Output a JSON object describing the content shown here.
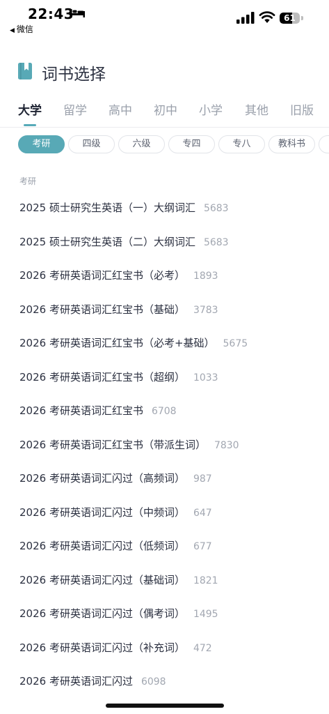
{
  "status_bar": {
    "time": "22:43",
    "back_app": "微信",
    "battery": "61",
    "battery_level": 0.61
  },
  "header": {
    "title": "词书选择",
    "accent_color": "#58a9b6"
  },
  "tabs": [
    {
      "label": "大学",
      "active": true
    },
    {
      "label": "留学",
      "active": false
    },
    {
      "label": "高中",
      "active": false
    },
    {
      "label": "初中",
      "active": false
    },
    {
      "label": "小学",
      "active": false
    },
    {
      "label": "其他",
      "active": false
    },
    {
      "label": "旧版",
      "active": false
    }
  ],
  "chips": [
    {
      "label": "考研",
      "active": true
    },
    {
      "label": "四级",
      "active": false
    },
    {
      "label": "六级",
      "active": false
    },
    {
      "label": "专四",
      "active": false
    },
    {
      "label": "专八",
      "active": false
    },
    {
      "label": "教科书",
      "active": false
    },
    {
      "label": "",
      "active": false
    }
  ],
  "section": {
    "label": "考研"
  },
  "books": [
    {
      "name": "2025 硕士研究生英语（一）大纲词汇",
      "count": "5683"
    },
    {
      "name": "2025 硕士研究生英语（二）大纲词汇",
      "count": "5683"
    },
    {
      "name": "2026 考研英语词汇红宝书（必考）",
      "count": "1893"
    },
    {
      "name": "2026 考研英语词汇红宝书（基础）",
      "count": "3783"
    },
    {
      "name": "2026 考研英语词汇红宝书（必考+基础）",
      "count": "5675"
    },
    {
      "name": "2026 考研英语词汇红宝书（超纲）",
      "count": "1033"
    },
    {
      "name": "2026 考研英语词汇红宝书",
      "count": "6708"
    },
    {
      "name": "2026 考研英语词汇红宝书（带派生词）",
      "count": "7830"
    },
    {
      "name": "2026 考研英语词汇闪过（高频词）",
      "count": "987"
    },
    {
      "name": "2026 考研英语词汇闪过（中频词）",
      "count": "647"
    },
    {
      "name": "2026 考研英语词汇闪过（低频词）",
      "count": "677"
    },
    {
      "name": "2026 考研英语词汇闪过（基础词）",
      "count": "1821"
    },
    {
      "name": "2026 考研英语词汇闪过（偶考词）",
      "count": "1495"
    },
    {
      "name": "2026 考研英语词汇闪过（补充词）",
      "count": "472"
    },
    {
      "name": "2026 考研英语词汇闪过",
      "count": "6098"
    }
  ]
}
